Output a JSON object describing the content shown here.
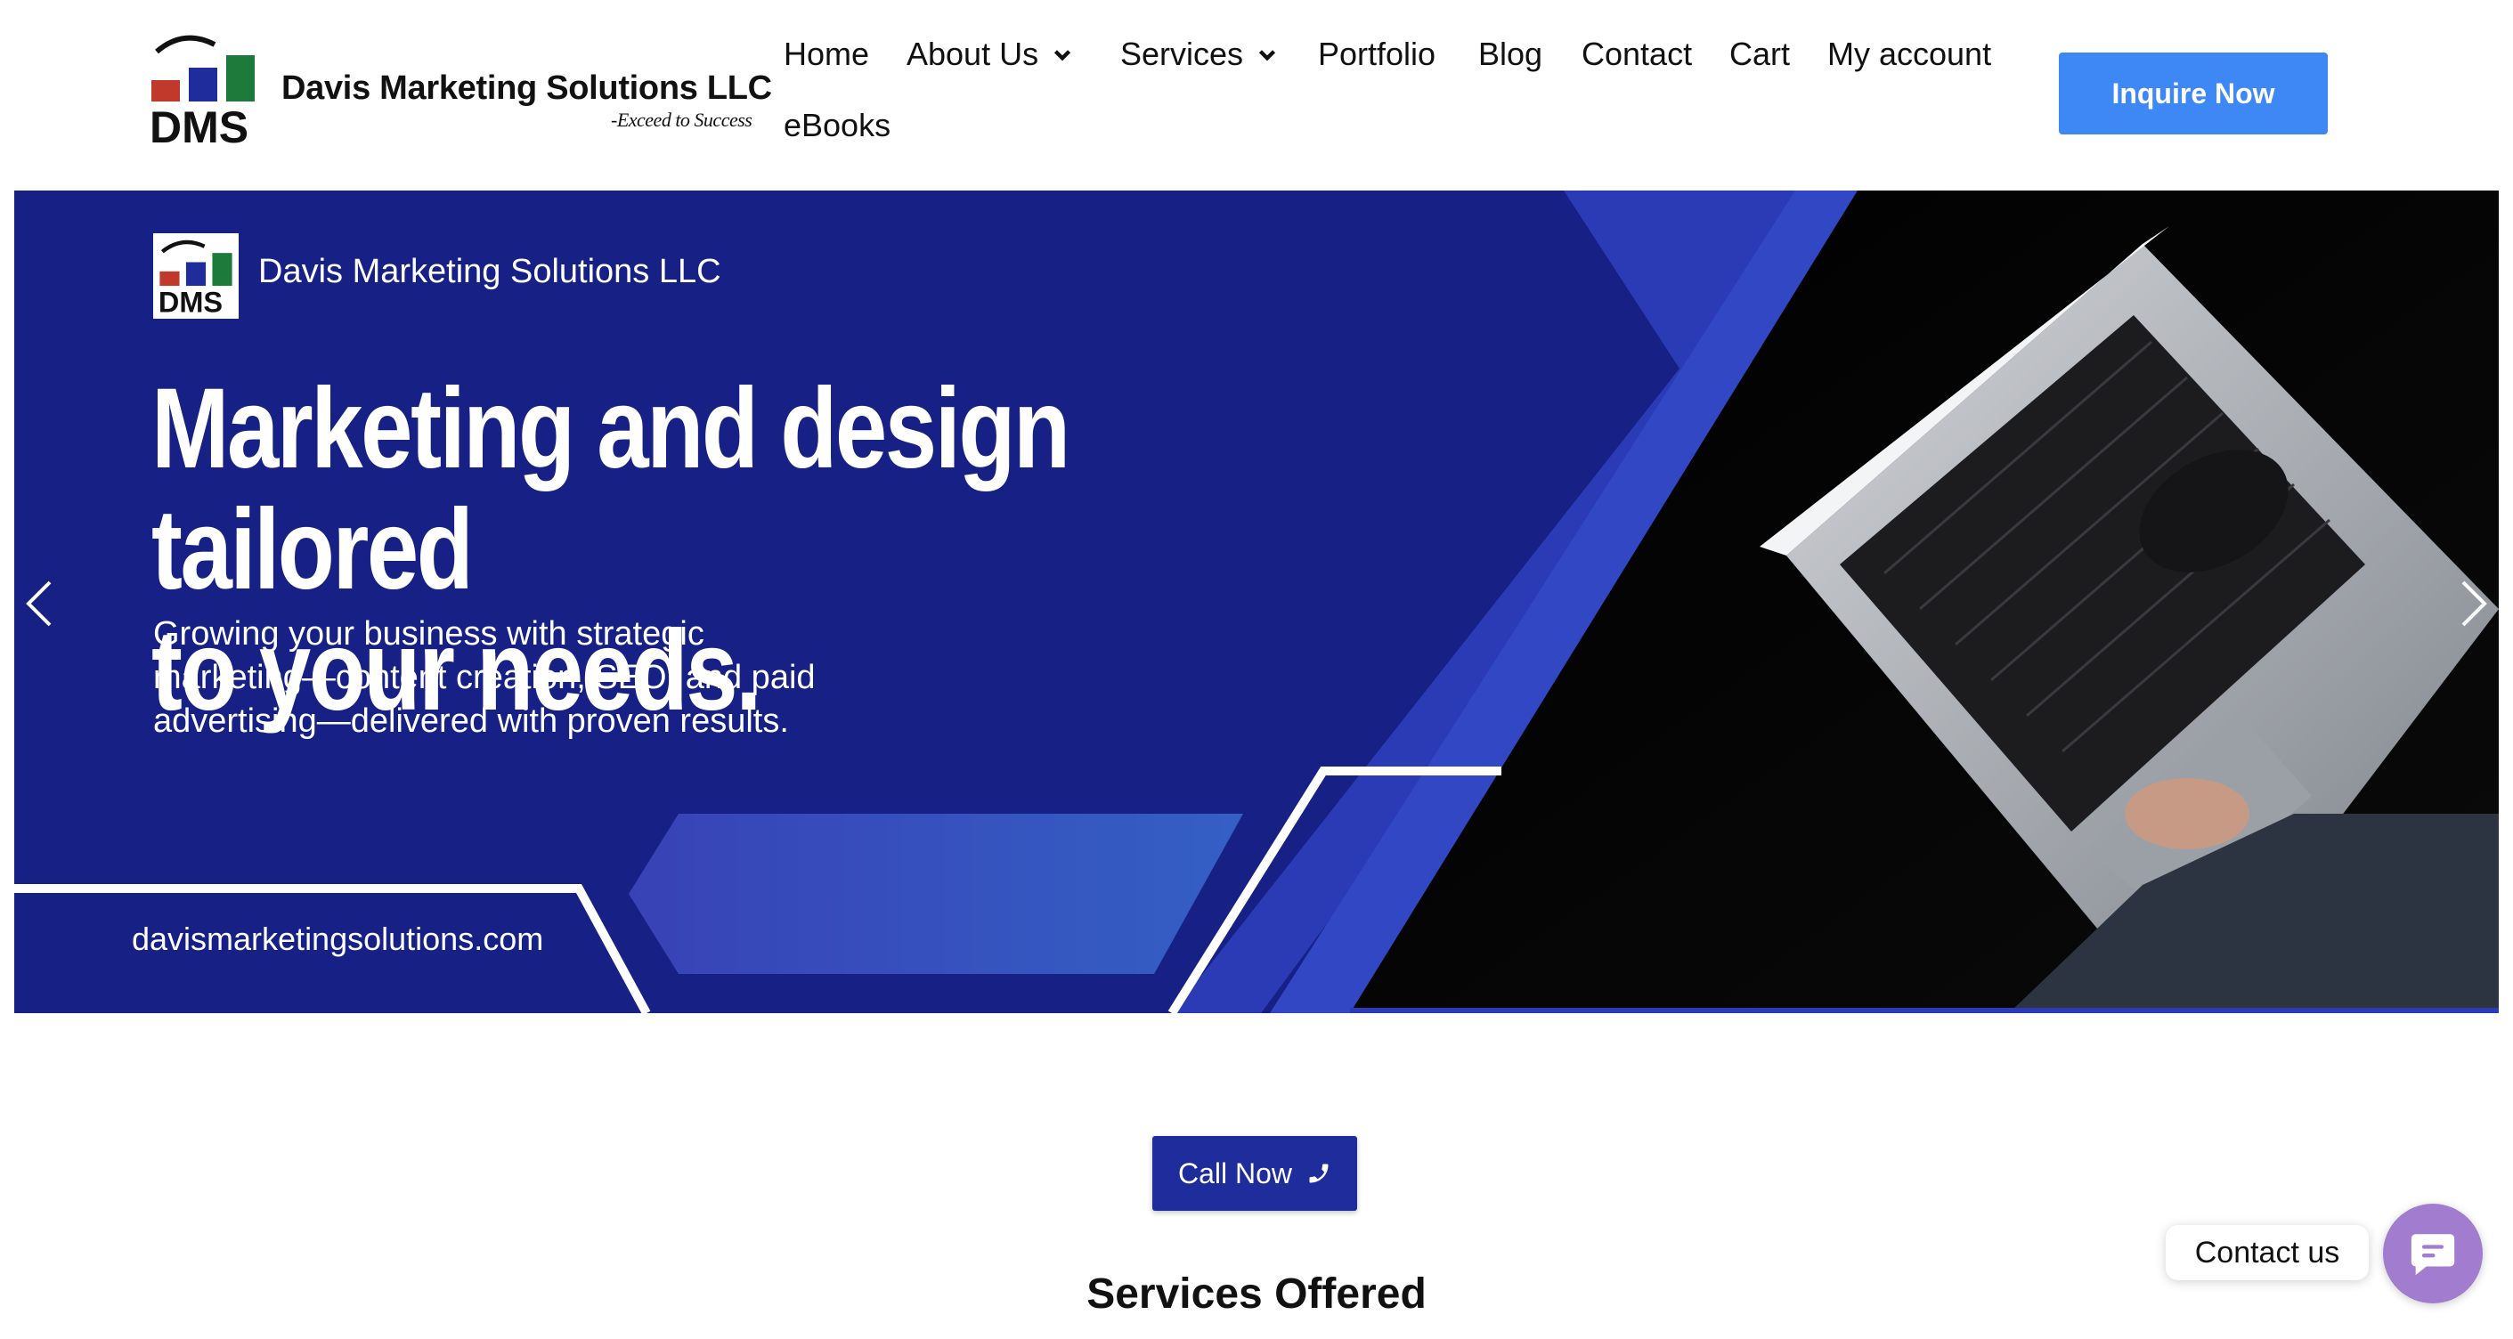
{
  "header": {
    "brand_name": "Davis Marketing Solutions LLC",
    "brand_tagline": "-Exceed to Success",
    "logo_text": "DMS",
    "nav": [
      {
        "label": "Home",
        "has_dropdown": false
      },
      {
        "label": "About Us",
        "has_dropdown": true
      },
      {
        "label": "Services",
        "has_dropdown": true
      },
      {
        "label": "Portfolio",
        "has_dropdown": false
      },
      {
        "label": "Blog",
        "has_dropdown": false
      },
      {
        "label": "Contact",
        "has_dropdown": false
      },
      {
        "label": "Cart",
        "has_dropdown": false
      },
      {
        "label": "My account",
        "has_dropdown": false
      },
      {
        "label": "eBooks",
        "has_dropdown": false
      }
    ],
    "cta_label": "Inquire Now"
  },
  "hero": {
    "brand": "Davis Marketing Solutions LLC",
    "logo_text": "DMS",
    "title_line1": "Marketing and design tailored",
    "title_line2": "to your needs.",
    "subtitle_line1": "Growing your business with strategic",
    "subtitle_line2": "marketing—content creation, SEO, and paid",
    "subtitle_line3": "advertising—delivered with proven results.",
    "url": "davismarketingsolutions.com"
  },
  "main": {
    "call_label": "Call Now",
    "services_heading": "Services Offered"
  },
  "chat": {
    "label": "Contact us"
  },
  "colors": {
    "accent_blue": "#3e88f5",
    "hero_navy": "#172185",
    "call_button": "#1f2c9b",
    "chat_purple": "#a27cce"
  }
}
